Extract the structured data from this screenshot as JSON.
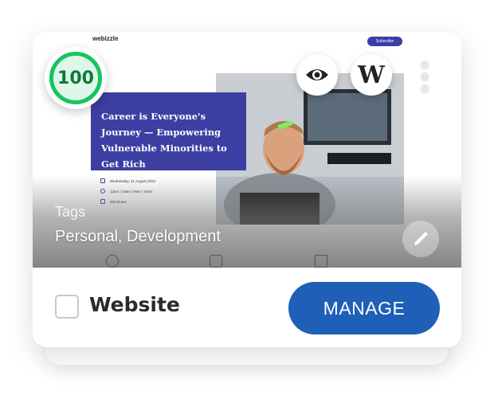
{
  "site": {
    "logo_text": "webizzle",
    "subscribe_label": "Subscribe",
    "hero_title": "Career is Everyone's Journey — Empowering Vulnerable Minorities to Get Rich",
    "meta": {
      "date": "Wednesday, 21 August 2022",
      "time": "12pm | 10am | 9am | 10am",
      "duration": "60minutes"
    }
  },
  "card": {
    "tags_label": "Tags",
    "tags_value": "Personal, Development",
    "website_label": "Website",
    "manage_label": "MANAGE",
    "wp_glyph": "W",
    "score": "100"
  },
  "icons": [
    "eye-icon",
    "wordpress-icon",
    "kebab-menu-icon",
    "pencil-icon",
    "calendar-icon",
    "clock-icon",
    "hourglass-icon",
    "smiley-icon",
    "fist-icon",
    "chart-icon"
  ],
  "colors": {
    "accent": "#1f5fb8",
    "hero_box": "#3c3fa2",
    "score_green": "#17c460"
  }
}
